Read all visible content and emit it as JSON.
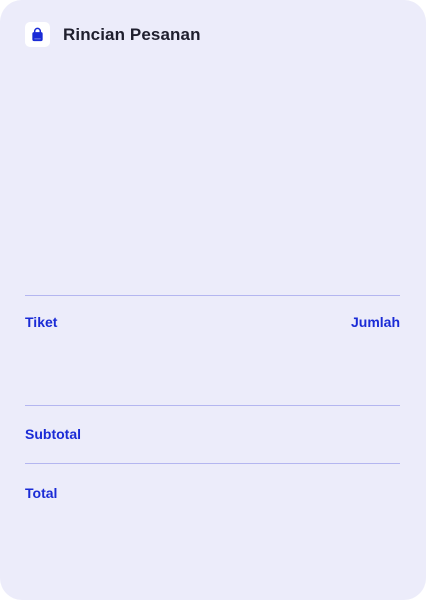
{
  "header": {
    "title": "Rincian Pesanan",
    "icon": "shopping-bag-icon"
  },
  "ticket_section": {
    "label": "Tiket",
    "quantity_label": "Jumlah"
  },
  "subtotal": {
    "label": "Subtotal"
  },
  "total": {
    "label": "Total"
  },
  "colors": {
    "card_background": "#ececfa",
    "accent": "#1a2bd6",
    "divider": "#b4b6f0",
    "title_text": "#1f1f2e"
  }
}
